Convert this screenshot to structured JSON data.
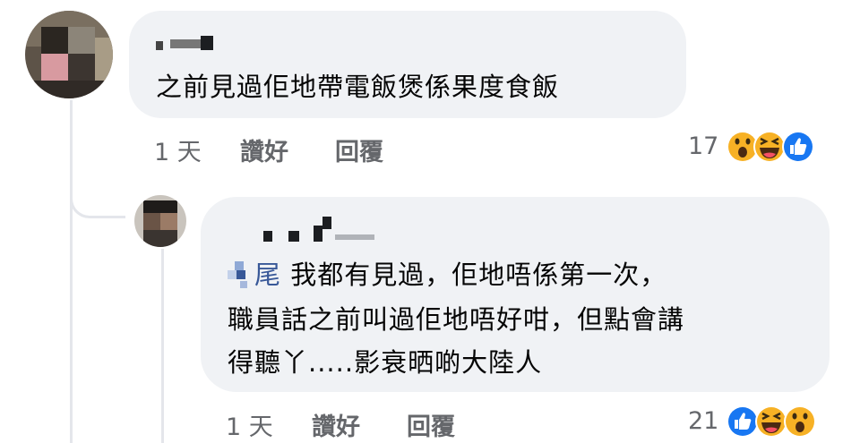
{
  "comments": [
    {
      "text": "之前見過佢地帶電飯煲係果度食飯",
      "time": "1 天",
      "like_label": "讚好",
      "reply_label": "回覆",
      "reaction_count": "17",
      "reactions": [
        "wow-reaction-icon",
        "haha-reaction-icon",
        "like-reaction-icon"
      ]
    },
    {
      "mention": "尾",
      "text_line1": "我都有見過，佢地唔係第一次，",
      "text_line2": "職員話之前叫過佢地唔好咁，但點會講",
      "text_line3": "得聽丫.....影衰晒啲大陸人",
      "time": "1 天",
      "like_label": "讚好",
      "reply_label": "回覆",
      "reaction_count": "21",
      "reactions": [
        "like-reaction-icon",
        "haha-reaction-icon",
        "wow-reaction-icon"
      ]
    }
  ],
  "colors": {
    "bubble": "#f0f2f5",
    "text": "#050505",
    "meta": "#65676b",
    "like_blue": "#1877f2",
    "emoji_yellow": "#f7b125"
  }
}
